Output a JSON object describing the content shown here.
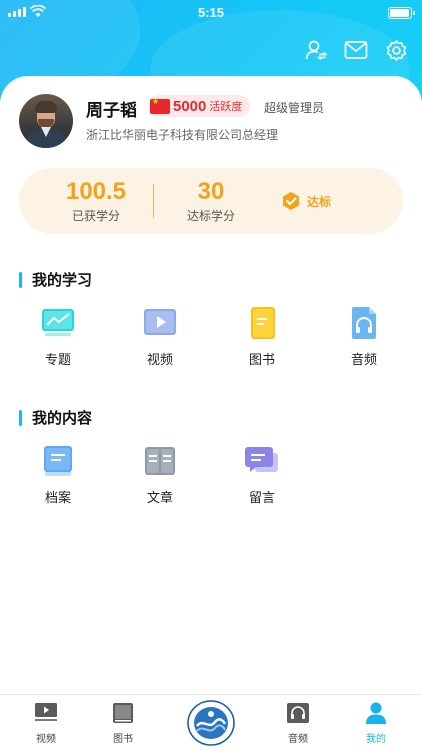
{
  "status_bar": {
    "time": "5:15"
  },
  "profile": {
    "name": "周子韬",
    "activity_score": "5000",
    "activity_label": "活跃度",
    "role": "超级管理员",
    "company": "浙江比华丽电子科技有限公司总经理"
  },
  "scores": {
    "earned_value": "100.5",
    "earned_label": "已获学分",
    "target_value": "30",
    "target_label": "达标学分",
    "status_label": "达标",
    "accent_color": "#f3a31a"
  },
  "my_learning": {
    "title": "我的学习",
    "items": [
      {
        "label": "专题",
        "icon": "topic-monitor-icon"
      },
      {
        "label": "视频",
        "icon": "video-icon"
      },
      {
        "label": "图书",
        "icon": "book-icon"
      },
      {
        "label": "音频",
        "icon": "audio-headphones-icon"
      }
    ]
  },
  "my_content": {
    "title": "我的内容",
    "items": [
      {
        "label": "档案",
        "icon": "archive-icon"
      },
      {
        "label": "文章",
        "icon": "article-icon"
      },
      {
        "label": "留言",
        "icon": "message-icon"
      }
    ]
  },
  "tabbar": {
    "tabs": [
      {
        "label": "视频",
        "icon": "video-tab-icon",
        "active": false
      },
      {
        "label": "图书",
        "icon": "book-tab-icon",
        "active": false
      },
      {
        "label": "音频",
        "icon": "audio-tab-icon",
        "active": false
      },
      {
        "label": "我的",
        "icon": "profile-tab-icon",
        "active": true
      }
    ],
    "active_color": "#19b2ee"
  },
  "colors": {
    "header": "#1fb7f5",
    "section_accent": "#18b6f2"
  }
}
